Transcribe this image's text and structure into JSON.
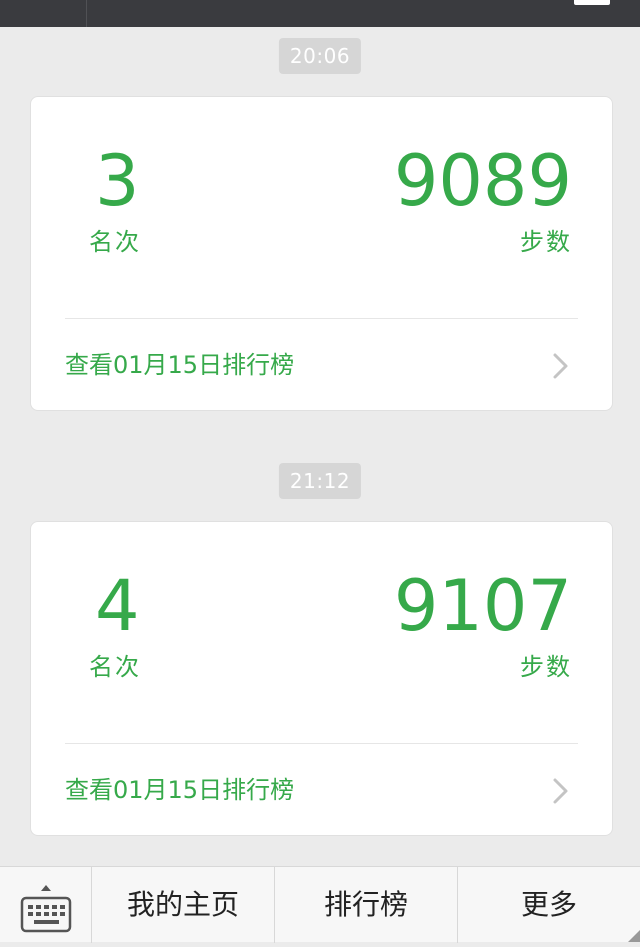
{
  "colors": {
    "accent": "#36a94a",
    "background": "#ebebeb",
    "card": "#ffffff",
    "timestamp_bg": "#d6d6d6"
  },
  "messages": [
    {
      "time": "20:06",
      "rank": "3",
      "rank_label": "名次",
      "steps": "9089",
      "steps_label": "步数",
      "link": "查看01月15日排行榜"
    },
    {
      "time": "21:12",
      "rank": "4",
      "rank_label": "名次",
      "steps": "9107",
      "steps_label": "步数",
      "link": "查看01月15日排行榜"
    }
  ],
  "bottom_menu": {
    "keyboard_icon": "keyboard-icon",
    "items": [
      "我的主页",
      "排行榜",
      "更多"
    ]
  }
}
